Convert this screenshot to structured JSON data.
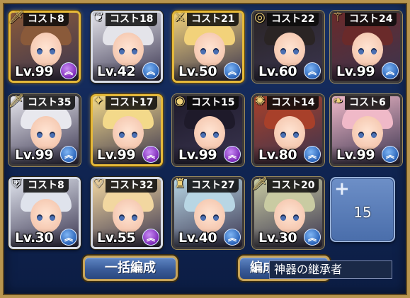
{
  "cost_prefix": "コスト",
  "units": [
    {
      "cost": "8",
      "level": "Lv.99",
      "rank": "purple",
      "frame": "gold",
      "icon": "sword-icon",
      "icon_glyph": "🗡",
      "hair": "#8a5a3a"
    },
    {
      "cost": "18",
      "level": "Lv.42",
      "rank": "blue",
      "frame": "silver",
      "icon": "wing-icon",
      "icon_glyph": "❦",
      "hair": "#e4e4ea"
    },
    {
      "cost": "21",
      "level": "Lv.50",
      "rank": "blue",
      "frame": "gold",
      "icon": "spear-icon",
      "icon_glyph": "⚔",
      "hair": "#f2d27a"
    },
    {
      "cost": "22",
      "level": "Lv.60",
      "rank": "blue",
      "frame": "black",
      "icon": "ring-icon",
      "icon_glyph": "◎",
      "hair": "#2a2424"
    },
    {
      "cost": "24",
      "level": "Lv.99",
      "rank": "blue",
      "frame": "black",
      "icon": "staff-icon",
      "icon_glyph": "⚚",
      "hair": "#6a2a2a"
    },
    {
      "cost": "35",
      "level": "Lv.99",
      "rank": "blue",
      "frame": "black",
      "icon": "sword-icon",
      "icon_glyph": "🗡",
      "hair": "#e8e8ee"
    },
    {
      "cost": "17",
      "level": "Lv.99",
      "rank": "purple",
      "frame": "gold",
      "icon": "wand-icon",
      "icon_glyph": "✦",
      "hair": "#f3d98a"
    },
    {
      "cost": "15",
      "level": "Lv.99",
      "rank": "purple",
      "frame": "black",
      "icon": "ring-icon",
      "icon_glyph": "◉",
      "hair": "#1e1a2a"
    },
    {
      "cost": "14",
      "level": "Lv.80",
      "rank": "blue",
      "frame": "black",
      "icon": "gear-icon",
      "icon_glyph": "✺",
      "hair": "#a8402a"
    },
    {
      "cost": "6",
      "level": "Lv.99",
      "rank": "blue",
      "frame": "black",
      "icon": "boot-icon",
      "icon_glyph": "❧",
      "hair": "#f0b9c8"
    },
    {
      "cost": "8",
      "level": "Lv.30",
      "rank": "blue",
      "frame": "silver",
      "icon": "shield-icon",
      "icon_glyph": "⛨",
      "hair": "#dfe3ec"
    },
    {
      "cost": "32",
      "level": "Lv.55",
      "rank": "purple",
      "frame": "silver",
      "icon": "heart-icon",
      "icon_glyph": "♡",
      "hair": "#f2d7a0"
    },
    {
      "cost": "27",
      "level": "Lv.40",
      "rank": "blue",
      "frame": "black",
      "icon": "helmet-icon",
      "icon_glyph": "♜",
      "hair": "#b8d6e4"
    },
    {
      "cost": "20",
      "level": "Lv.30",
      "rank": "blue",
      "frame": "black",
      "icon": "sword-icon",
      "icon_glyph": "🗡",
      "hair": "#c9cba2"
    }
  ],
  "add_slot": {
    "count": "15"
  },
  "buttons": {
    "bulk_edit": "一括編成",
    "edit_partial": "編成"
  },
  "tooltip": "神器の継承者",
  "colors": {
    "rank_blue": "#2a63b8",
    "rank_purple": "#7d2ab8",
    "frame_gold": "#e5b93a"
  }
}
